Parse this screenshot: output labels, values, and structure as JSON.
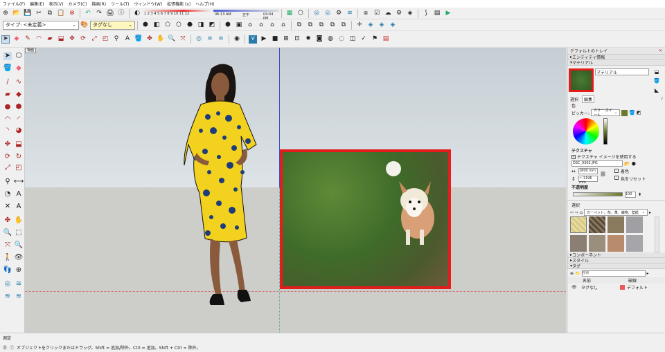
{
  "menu": [
    "ファイル(F)",
    "編集(E)",
    "表示(V)",
    "カメラ(C)",
    "描画(R)",
    "ツール(T)",
    "ウィンドウ(W)",
    "拡張機能 (x)",
    "ヘルプ(H)"
  ],
  "timebar": {
    "months": "1 2 3 4 5 6 7 8 9 10 11 12",
    "sunrise": "06:13 AM",
    "noon": "正午",
    "sunset": "04:34 PM"
  },
  "style_combo": "タイプ: <未定義>",
  "tag_combo": "タグなし",
  "scene_tab": "場面",
  "tray": {
    "title": "デフォルトのトレイ",
    "sections": {
      "entity": "エンティティ情報",
      "materials": "マテリアル",
      "components": "コンポーネント",
      "styles": "スタイル",
      "tags": "タグ"
    },
    "material_name": "マテリアル",
    "tabs": {
      "select": "選択",
      "edit": "編集"
    },
    "color_label": "色",
    "picker_label": "ピッカー:",
    "picker_value": "カラー ホイール",
    "texture_label": "テクスチャ",
    "use_texture": "テクスチャ イメージを使用する",
    "texture_file": "DSC_0302.JPG",
    "width": "1800 mm",
    "height": "~ 1196 mm",
    "colorize": "着色",
    "reset_color": "色をリセット",
    "opacity_label": "不透明度",
    "opacity_value": "100",
    "select_label": "選択",
    "library": "カーペット、布、革、織物、壁紙",
    "search_placeholder": "検索",
    "tags_cols": {
      "name": "名前",
      "color": "破線"
    },
    "tag_row": {
      "name": "タグなし",
      "dash": "デフォルト"
    }
  },
  "status": {
    "measure_label": "測定",
    "hint": "オブジェクトをクリックまたはドラッグ。Shift = 追加/除外。Ctrl = 追加。Shift + Ctrl = 除外。"
  },
  "colors": {
    "accent": "#e41c1c",
    "yellow": "#f2d21e",
    "navy": "#1d3d7a",
    "skin": "#8a5a3c"
  }
}
